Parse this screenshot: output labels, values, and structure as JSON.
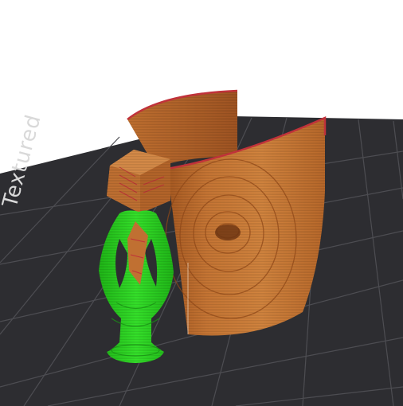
{
  "viewport": {
    "bed_label": "Textured",
    "colors": {
      "background": "#ffffff",
      "bed": "#2d2d31",
      "grid": "#4d4d52",
      "wall_perimeter": "#c4702e",
      "wall_edge": "#c0323a",
      "support": "#27d71f",
      "support_dark": "#1c9f17"
    },
    "objects": [
      {
        "name": "curved-wall",
        "feature": "external-perimeter"
      },
      {
        "name": "cube-model",
        "feature": "perimeter"
      },
      {
        "name": "tree-support",
        "feature": "support-material"
      }
    ]
  }
}
